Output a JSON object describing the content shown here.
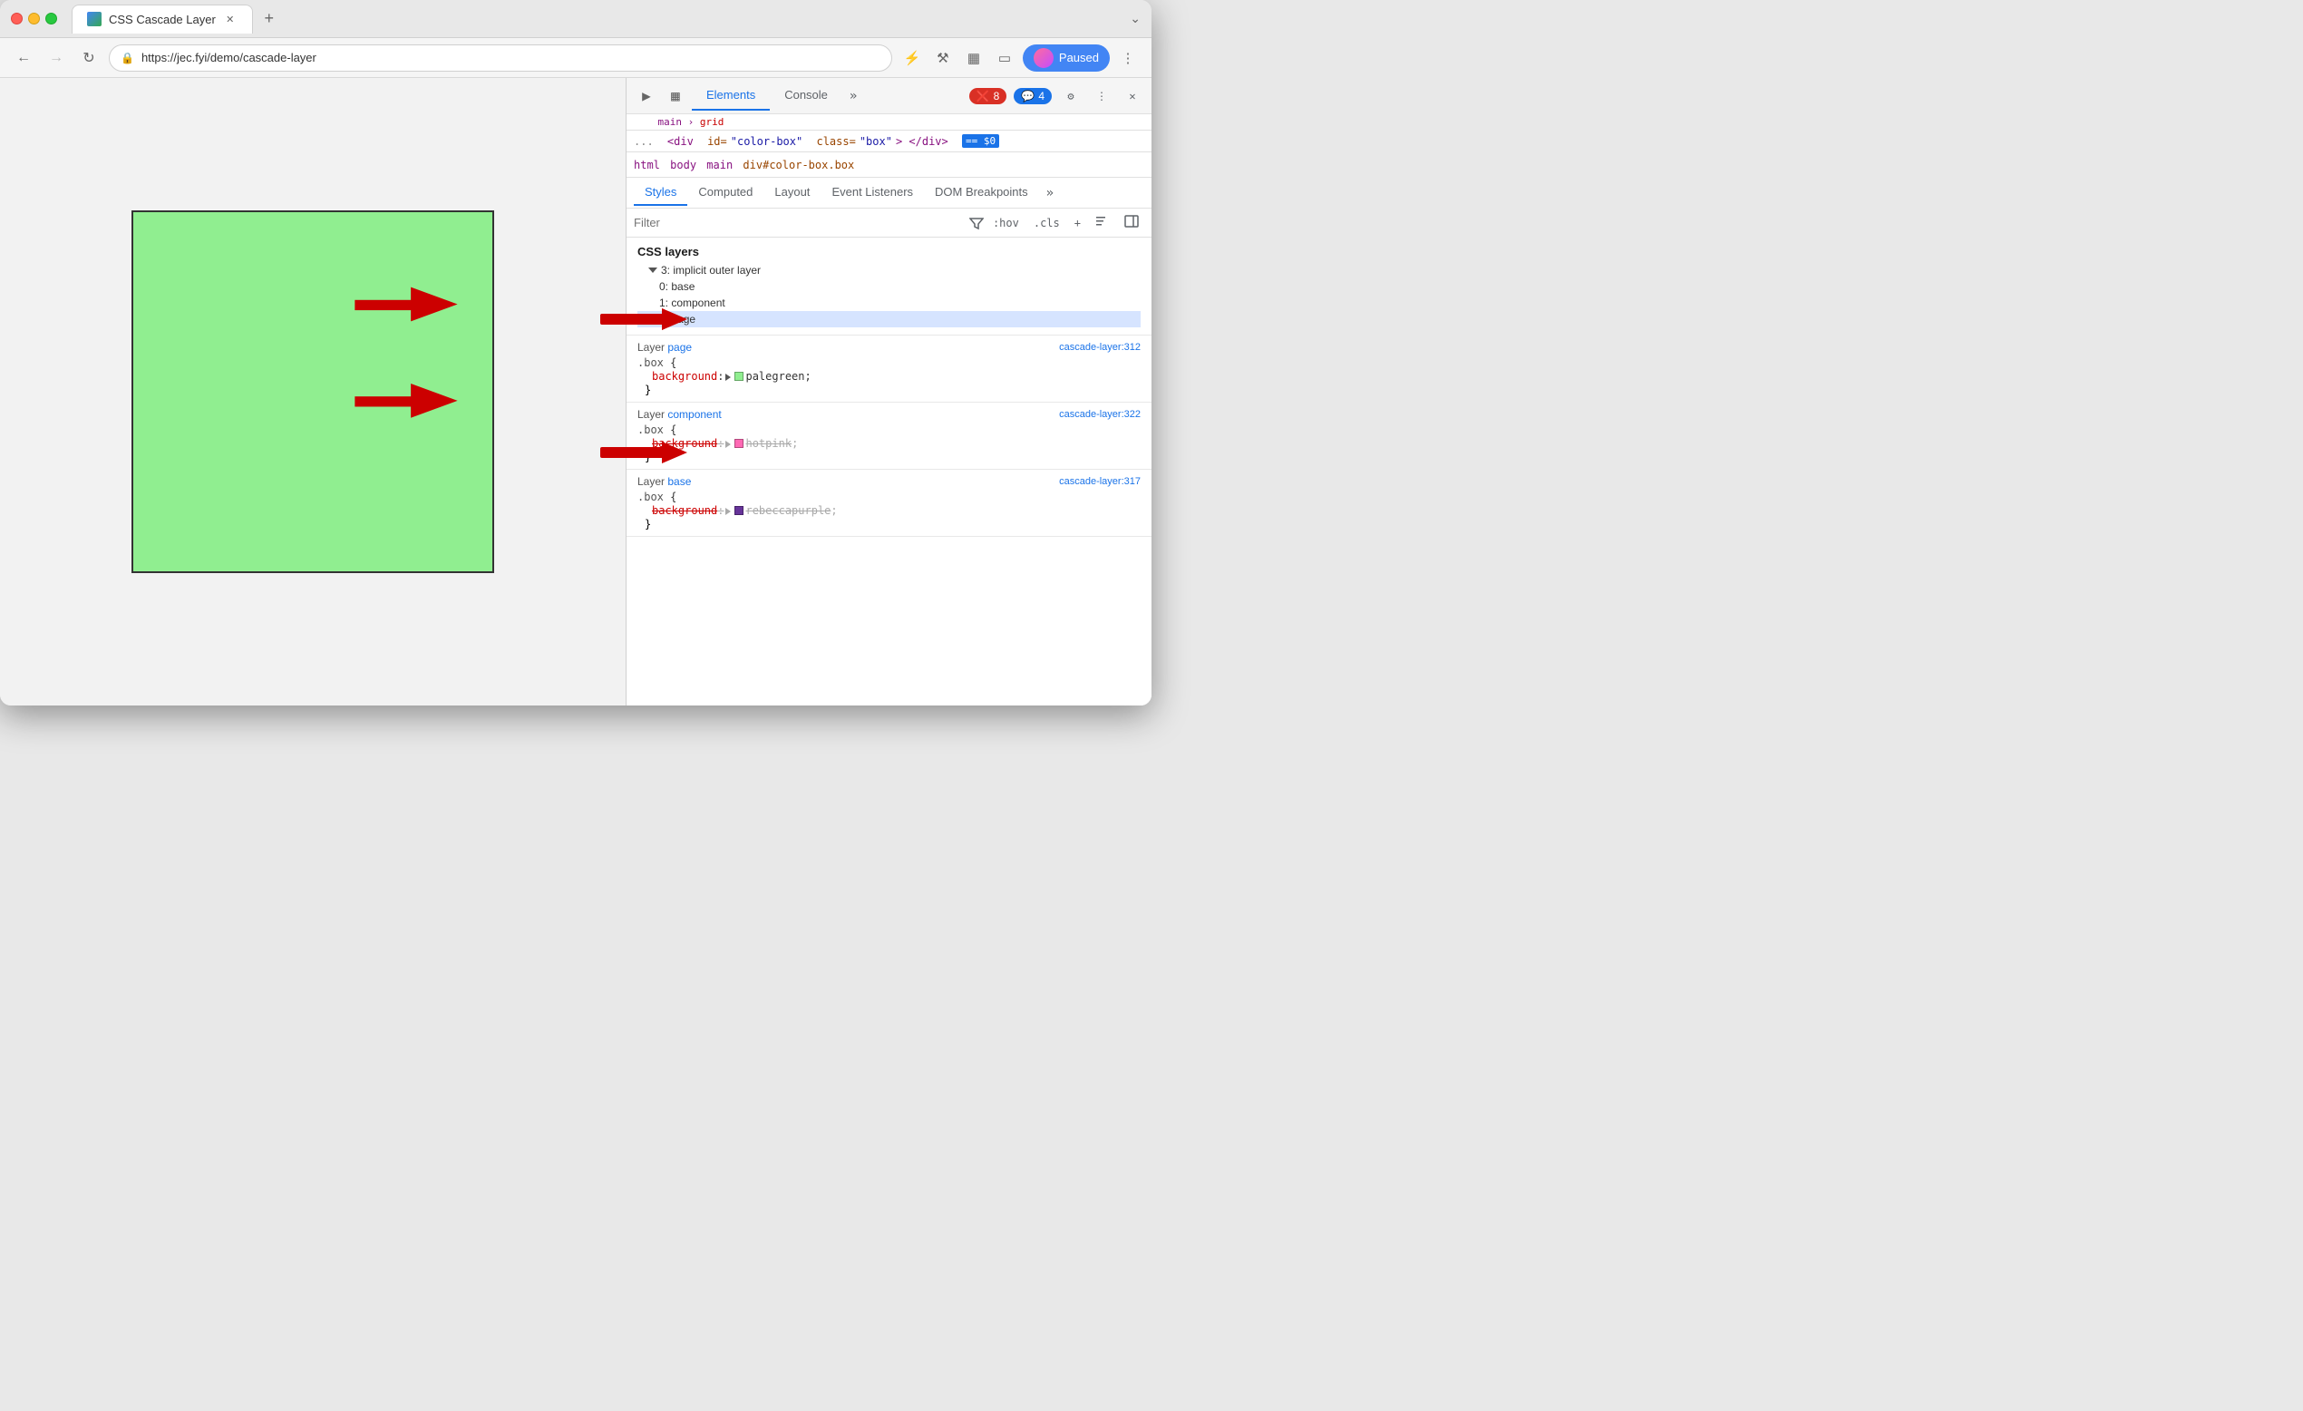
{
  "browser": {
    "tab_title": "CSS Cascade Layer",
    "tab_favicon_alt": "page-favicon",
    "url": "https://jec.fyi/demo/cascade-layer",
    "nav": {
      "back_disabled": false,
      "forward_disabled": true,
      "refresh_label": "↻",
      "paused_label": "Paused",
      "menu_dots": "⋮"
    }
  },
  "devtools": {
    "panel_tabs": [
      "Elements",
      "Console"
    ],
    "active_panel_tab": "Elements",
    "error_count": "8",
    "warning_count": "4",
    "breadcrumb": [
      "html",
      "body",
      "main",
      "div#color-box.box"
    ],
    "dom_node": "<div id=\"color-box\" class=\"box\"> </div>",
    "dollar_sign": "== $0",
    "subtabs": [
      "Styles",
      "Computed",
      "Layout",
      "Event Listeners",
      "DOM Breakpoints"
    ],
    "active_subtab": "Styles",
    "filter_placeholder": "Filter",
    "filter_hov": ":hov",
    "filter_cls": ".cls",
    "css_layers_title": "CSS layers",
    "layers": [
      {
        "label": "3: implicit outer layer",
        "indent": 0,
        "expanded": true
      },
      {
        "label": "0: base",
        "indent": 1
      },
      {
        "label": "1: component",
        "indent": 1
      },
      {
        "label": "2: page",
        "indent": 1,
        "selected": true
      }
    ],
    "rules": [
      {
        "layer_label": "Layer ",
        "layer_name": "page",
        "source": "cascade-layer:312",
        "selector": ".box",
        "properties": [
          {
            "name": "background",
            "value": "palegreen",
            "color": "#90ee90",
            "strikethrough": false
          }
        ]
      },
      {
        "layer_label": "Layer ",
        "layer_name": "component",
        "source": "cascade-layer:322",
        "selector": ".box",
        "properties": [
          {
            "name": "background",
            "value": "hotpink",
            "color": "#ff69b4",
            "strikethrough": true
          }
        ]
      },
      {
        "layer_label": "Layer ",
        "layer_name": "base",
        "source": "cascade-layer:317",
        "selector": ".box",
        "properties": [
          {
            "name": "background",
            "value": "rebeccapurple",
            "color": "#663399",
            "strikethrough": true
          }
        ]
      }
    ],
    "arrows": [
      {
        "label": "CSS layers arrow",
        "points_to": "css-layers"
      },
      {
        "label": "Layer page arrow",
        "points_to": "layer-page"
      }
    ]
  }
}
